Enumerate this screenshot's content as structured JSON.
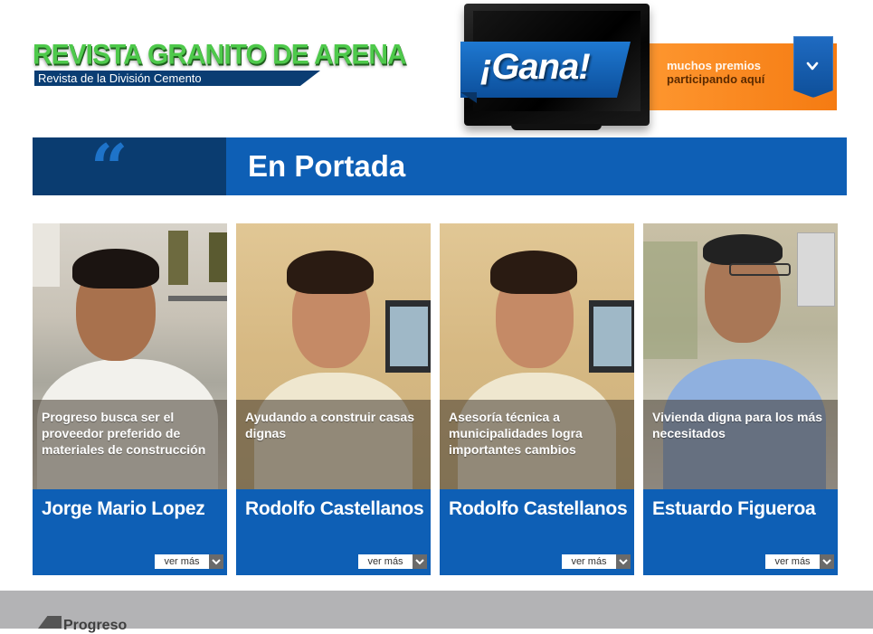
{
  "logo": {
    "title": "REVISTA GRANITO DE ARENA",
    "subtitle": "Revista de la División Cemento"
  },
  "promo": {
    "headline": "¡Gana!",
    "line1": "muchos premios",
    "line2": "participando aquí",
    "button_icon": "chevron-down-icon"
  },
  "section": {
    "icon": "quote-icon",
    "title": "En Portada"
  },
  "cards": [
    {
      "caption": "Progreso busca ser el proveedor preferido de materiales de construcción",
      "name": "Jorge Mario Lopez",
      "more_label": "ver más"
    },
    {
      "caption": "Ayudando a construir casas dignas",
      "name": "Rodolfo Castellanos",
      "more_label": "ver más"
    },
    {
      "caption": "Asesoría técnica a municipalidades logra importantes cambios",
      "name": "Rodolfo Castellanos",
      "more_label": "ver más"
    },
    {
      "caption": "Vivienda digna para los más necesitados",
      "name": "Estuardo Figueroa",
      "more_label": "ver más"
    }
  ],
  "footer": {
    "brand": "Progreso"
  },
  "colors": {
    "primary_blue": "#0e5fb5",
    "dark_blue": "#0a3c70",
    "logo_green": "#4ec94b",
    "promo_orange": "#f57b12",
    "footer_gray": "#b3b3b5"
  }
}
